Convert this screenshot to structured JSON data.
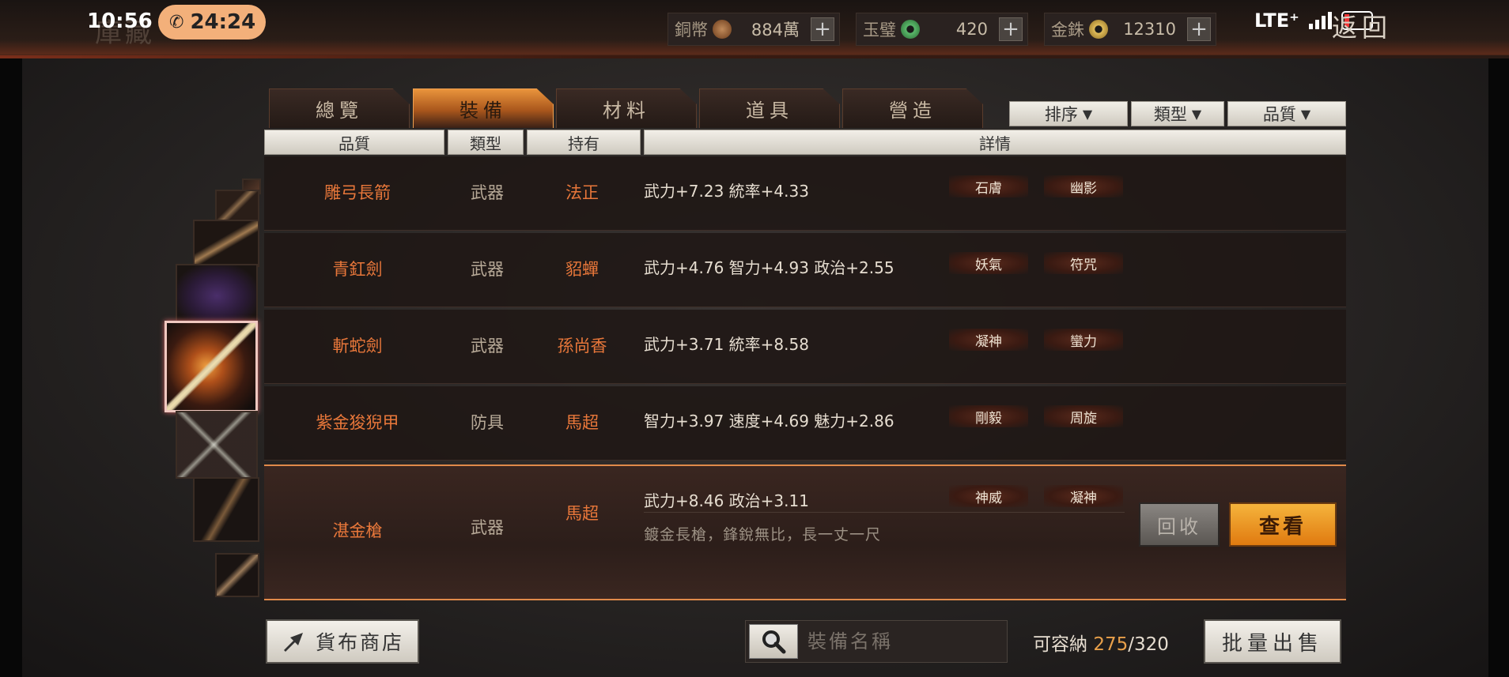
{
  "status_bar": {
    "time": "10:56",
    "call_timer": "24:24",
    "network": "LTE⁺"
  },
  "header": {
    "title": "庫藏",
    "back_label": "返回",
    "currencies": [
      {
        "name": "銅幣",
        "value": "884萬",
        "color": "#8a5a3a"
      },
      {
        "name": "玉璧",
        "value": "420",
        "color": "#3c8a4a"
      },
      {
        "name": "金銖",
        "value": "12310",
        "color": "#b8943a"
      }
    ]
  },
  "tabs": [
    {
      "label": "總覽"
    },
    {
      "label": "裝備",
      "active": true
    },
    {
      "label": "材料"
    },
    {
      "label": "道具"
    },
    {
      "label": "營造"
    }
  ],
  "filters": {
    "sort": "排序",
    "type": "類型",
    "quality": "品質"
  },
  "columns": {
    "quality": "品質",
    "type": "類型",
    "owner": "持有",
    "detail": "詳情"
  },
  "items": [
    {
      "name": "雕弓長箭",
      "type": "武器",
      "owner": "法正",
      "stats": "武力+7.23  統率+4.33",
      "traits": [
        "石膚",
        "幽影"
      ]
    },
    {
      "name": "青釭劍",
      "type": "武器",
      "owner": "貂蟬",
      "stats": "武力+4.76  智力+4.93  政治+2.55",
      "traits": [
        "妖氣",
        "符咒"
      ]
    },
    {
      "name": "斬蛇劍",
      "type": "武器",
      "owner": "孫尚香",
      "stats": "武力+3.71  統率+8.58",
      "traits": [
        "凝神",
        "蠻力"
      ]
    },
    {
      "name": "紫金狻猊甲",
      "type": "防具",
      "owner": "馬超",
      "stats": "智力+3.97  速度+4.69  魅力+2.86",
      "traits": [
        "剛毅",
        "周旋"
      ]
    },
    {
      "name": "湛金槍",
      "type": "武器",
      "owner": "馬超",
      "stats": "武力+8.46  政治+3.11",
      "traits": [
        "神威",
        "凝神"
      ],
      "description": "鍍金長槍，鋒銳無比，長一丈一尺",
      "selected": true
    }
  ],
  "actions": {
    "recycle": "回收",
    "view": "查看"
  },
  "footer": {
    "shop_label": "貨布商店",
    "search_placeholder": "裝備名稱",
    "capacity_label": "可容納",
    "capacity_current": "275",
    "capacity_separator": "/",
    "capacity_total": "320",
    "bulk_sell_label": "批量出售"
  }
}
